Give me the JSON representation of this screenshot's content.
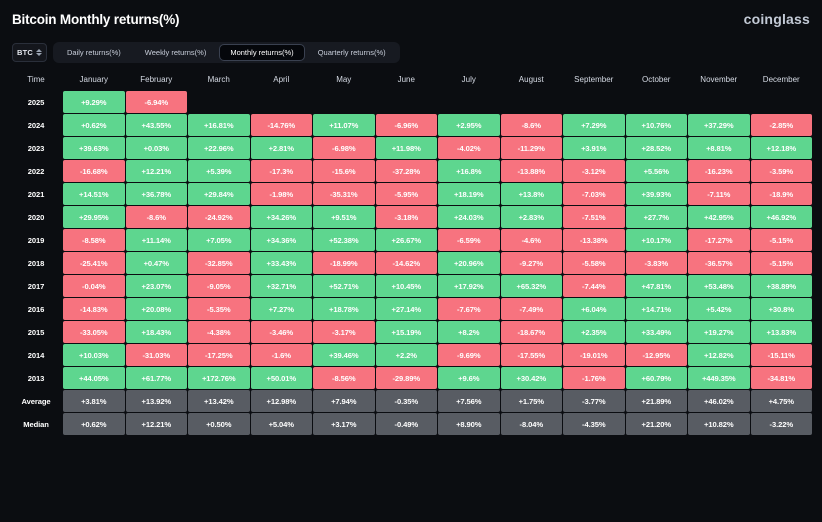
{
  "header": {
    "title": "Bitcoin Monthly returns(%)",
    "brand": "coinglass"
  },
  "controls": {
    "symbol": "BTC",
    "tabs": [
      {
        "label": "Daily returns(%)",
        "active": false
      },
      {
        "label": "Weekly returns(%)",
        "active": false
      },
      {
        "label": "Monthly returns(%)",
        "active": true
      },
      {
        "label": "Quarterly returns(%)",
        "active": false
      }
    ]
  },
  "colors": {
    "positive": "#5ed68f",
    "negative": "#f7737f",
    "neutral": "#585c63",
    "background": "#0b0d11"
  },
  "chart_data": {
    "type": "heatmap",
    "title": "Bitcoin Monthly returns(%)",
    "xlabel": "",
    "ylabel": "Time",
    "columns": [
      "Time",
      "January",
      "February",
      "March",
      "April",
      "May",
      "June",
      "July",
      "August",
      "September",
      "October",
      "November",
      "December"
    ],
    "rows": [
      {
        "label": "2025",
        "values": [
          "+9.29%",
          "-6.94%",
          "",
          "",
          "",
          "",
          "",
          "",
          "",
          "",
          "",
          ""
        ]
      },
      {
        "label": "2024",
        "values": [
          "+0.62%",
          "+43.55%",
          "+16.81%",
          "-14.76%",
          "+11.07%",
          "-6.96%",
          "+2.95%",
          "-8.6%",
          "+7.29%",
          "+10.76%",
          "+37.29%",
          "-2.85%"
        ]
      },
      {
        "label": "2023",
        "values": [
          "+39.63%",
          "+0.03%",
          "+22.96%",
          "+2.81%",
          "-6.98%",
          "+11.98%",
          "-4.02%",
          "-11.29%",
          "+3.91%",
          "+28.52%",
          "+8.81%",
          "+12.18%"
        ]
      },
      {
        "label": "2022",
        "values": [
          "-16.68%",
          "+12.21%",
          "+5.39%",
          "-17.3%",
          "-15.6%",
          "-37.28%",
          "+16.8%",
          "-13.88%",
          "-3.12%",
          "+5.56%",
          "-16.23%",
          "-3.59%"
        ]
      },
      {
        "label": "2021",
        "values": [
          "+14.51%",
          "+36.78%",
          "+29.84%",
          "-1.98%",
          "-35.31%",
          "-5.95%",
          "+18.19%",
          "+13.8%",
          "-7.03%",
          "+39.93%",
          "-7.11%",
          "-18.9%"
        ]
      },
      {
        "label": "2020",
        "values": [
          "+29.95%",
          "-8.6%",
          "-24.92%",
          "+34.26%",
          "+9.51%",
          "-3.18%",
          "+24.03%",
          "+2.83%",
          "-7.51%",
          "+27.7%",
          "+42.95%",
          "+46.92%"
        ]
      },
      {
        "label": "2019",
        "values": [
          "-8.58%",
          "+11.14%",
          "+7.05%",
          "+34.36%",
          "+52.38%",
          "+26.67%",
          "-6.59%",
          "-4.6%",
          "-13.38%",
          "+10.17%",
          "-17.27%",
          "-5.15%"
        ]
      },
      {
        "label": "2018",
        "values": [
          "-25.41%",
          "+0.47%",
          "-32.85%",
          "+33.43%",
          "-18.99%",
          "-14.62%",
          "+20.96%",
          "-9.27%",
          "-5.58%",
          "-3.83%",
          "-36.57%",
          "-5.15%"
        ]
      },
      {
        "label": "2017",
        "values": [
          "-0.04%",
          "+23.07%",
          "-9.05%",
          "+32.71%",
          "+52.71%",
          "+10.45%",
          "+17.92%",
          "+65.32%",
          "-7.44%",
          "+47.81%",
          "+53.48%",
          "+38.89%"
        ]
      },
      {
        "label": "2016",
        "values": [
          "-14.83%",
          "+20.08%",
          "-5.35%",
          "+7.27%",
          "+18.78%",
          "+27.14%",
          "-7.67%",
          "-7.49%",
          "+6.04%",
          "+14.71%",
          "+5.42%",
          "+30.8%"
        ]
      },
      {
        "label": "2015",
        "values": [
          "-33.05%",
          "+18.43%",
          "-4.38%",
          "-3.46%",
          "-3.17%",
          "+15.19%",
          "+8.2%",
          "-18.67%",
          "+2.35%",
          "+33.49%",
          "+19.27%",
          "+13.83%"
        ]
      },
      {
        "label": "2014",
        "values": [
          "+10.03%",
          "-31.03%",
          "-17.25%",
          "-1.6%",
          "+39.46%",
          "+2.2%",
          "-9.69%",
          "-17.55%",
          "-19.01%",
          "-12.95%",
          "+12.82%",
          "-15.11%"
        ]
      },
      {
        "label": "2013",
        "values": [
          "+44.05%",
          "+61.77%",
          "+172.76%",
          "+50.01%",
          "-8.56%",
          "-29.89%",
          "+9.6%",
          "+30.42%",
          "-1.76%",
          "+60.79%",
          "+449.35%",
          "-34.81%"
        ]
      },
      {
        "label": "Average",
        "values": [
          "+3.81%",
          "+13.92%",
          "+13.42%",
          "+12.98%",
          "+7.94%",
          "-0.35%",
          "+7.56%",
          "+1.75%",
          "-3.77%",
          "+21.89%",
          "+46.02%",
          "+4.75%"
        ],
        "neutral": true
      },
      {
        "label": "Median",
        "values": [
          "+0.62%",
          "+12.21%",
          "+0.50%",
          "+5.04%",
          "+3.17%",
          "-0.49%",
          "+8.90%",
          "-8.04%",
          "-4.35%",
          "+21.20%",
          "+10.82%",
          "-3.22%"
        ],
        "neutral": true
      }
    ]
  }
}
